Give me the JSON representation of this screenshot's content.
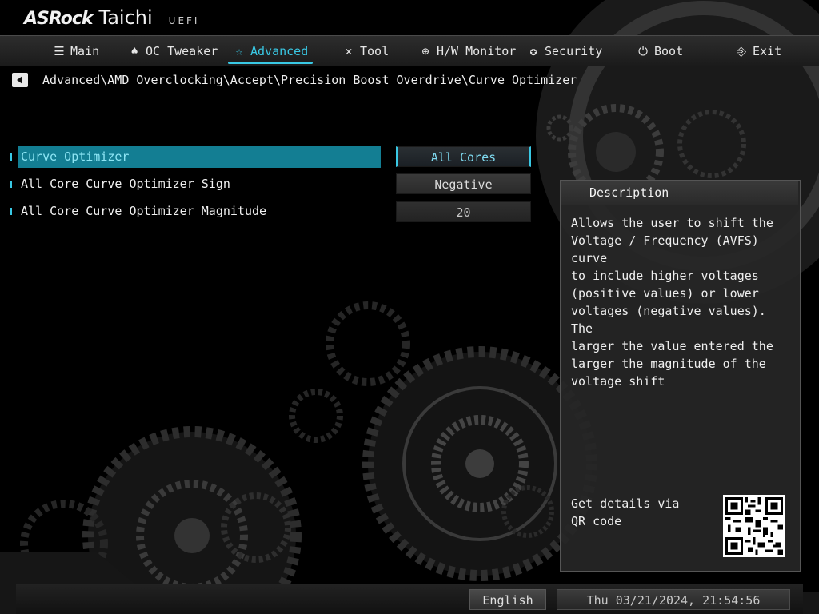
{
  "header": {
    "brand": "ASRock",
    "model": "Taichi",
    "uefi": "UEFI"
  },
  "nav": {
    "tabs": [
      {
        "label": "Main",
        "icon": "list-icon",
        "glyph": "☰"
      },
      {
        "label": "OC Tweaker",
        "icon": "rocket-icon",
        "glyph": "♠"
      },
      {
        "label": "Advanced",
        "icon": "star-icon",
        "glyph": "☆",
        "active": true
      },
      {
        "label": "Tool",
        "icon": "tools-icon",
        "glyph": "✕"
      },
      {
        "label": "H/W Monitor",
        "icon": "crosshair-icon",
        "glyph": "⊕"
      },
      {
        "label": "Security",
        "icon": "shield-icon",
        "glyph": "✪"
      },
      {
        "label": "Boot",
        "icon": "power-icon",
        "glyph": "⏻"
      },
      {
        "label": "Exit",
        "icon": "exit-door-icon",
        "glyph": "⎆"
      }
    ]
  },
  "breadcrumb": "Advanced\\AMD Overclocking\\Accept\\Precision Boost Overdrive\\Curve Optimizer",
  "settings": [
    {
      "label": "Curve Optimizer",
      "value": "All Cores",
      "selected": true
    },
    {
      "label": "All Core Curve Optimizer Sign",
      "value": "Negative"
    },
    {
      "label": "All Core Curve Optimizer Magnitude",
      "value": "20"
    }
  ],
  "description": {
    "title": "Description",
    "text": "Allows the user to shift the\nVoltage / Frequency (AVFS) curve\nto include higher voltages\n(positive values) or lower\nvoltages (negative values). The\nlarger the value entered the\nlarger the magnitude of the\nvoltage shift",
    "qr_text": "Get details via QR code"
  },
  "footer": {
    "language": "English",
    "datetime": "Thu 03/21/2024, 21:54:56"
  },
  "colors": {
    "accent": "#39c8e4",
    "selected_row": "#137e93",
    "background": "#000000"
  }
}
